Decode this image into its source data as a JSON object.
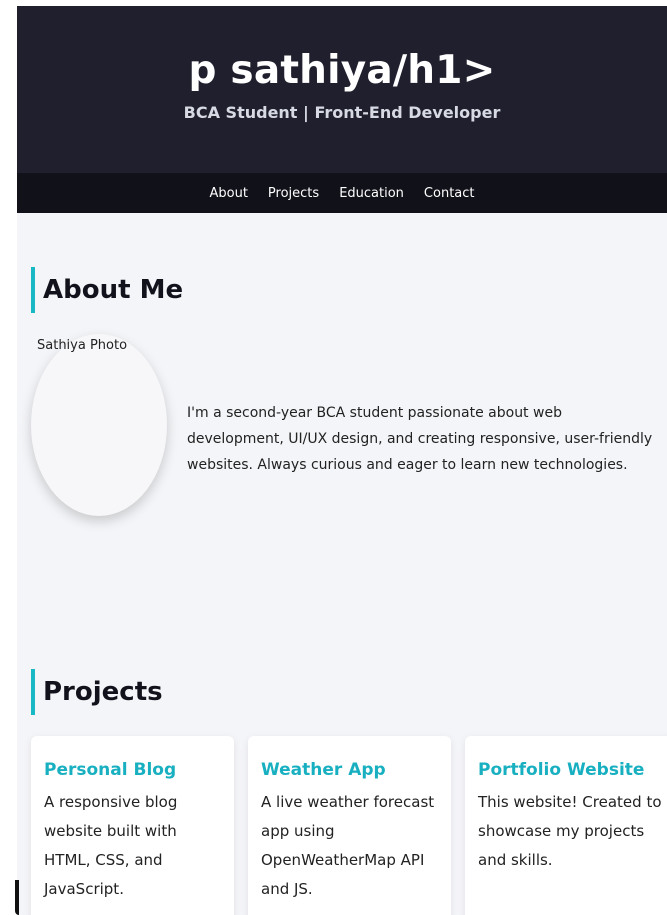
{
  "header": {
    "title": "p sathiya/h1>",
    "subtitle": "BCA Student | Front-End Developer"
  },
  "nav": {
    "items": [
      "About",
      "Projects",
      "Education",
      "Contact"
    ]
  },
  "about": {
    "heading": "About Me",
    "photo_alt": "Sathiya Photo",
    "description": "I'm a second-year BCA student passionate about web development, UI/UX design, and creating responsive, user-friendly websites. Always curious and eager to learn new technologies."
  },
  "projects": {
    "heading": "Projects",
    "cards": [
      {
        "title": "Personal Blog",
        "description": "A responsive blog website built with HTML, CSS, and JavaScript."
      },
      {
        "title": "Weather App",
        "description": "A live weather forecast app using OpenWeatherMap API and JS."
      },
      {
        "title": "Portfolio Website",
        "description": "This website! Created to showcase my projects and skills."
      }
    ]
  },
  "colors": {
    "header_bg": "#1f1f2e",
    "nav_bg": "#11111a",
    "accent": "#18b8c4",
    "page_bg": "#f4f5f8"
  }
}
